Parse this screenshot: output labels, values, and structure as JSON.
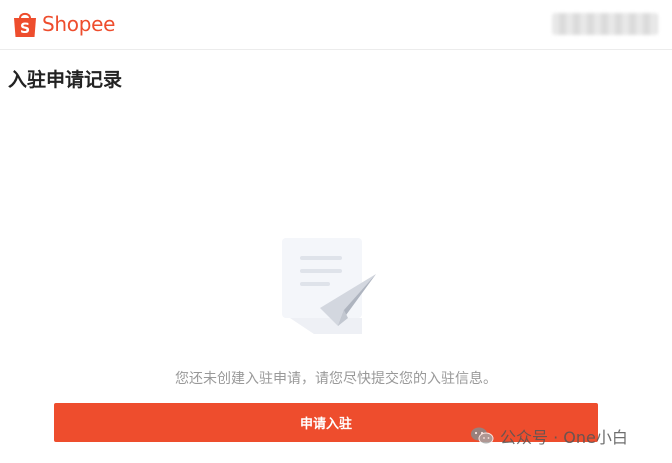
{
  "header": {
    "logo_text": "Shopee",
    "logo_bag_letter": "S"
  },
  "page": {
    "title": "入驻申请记录"
  },
  "empty_state": {
    "illustration": "empty-paper-plane-icon",
    "message": "您还未创建入驻申请，请您尽快提交您的入驻信息。"
  },
  "actions": {
    "apply_label": "申请入驻"
  },
  "watermark": {
    "icon": "wechat-icon",
    "text": "公众号 · One小白"
  },
  "colors": {
    "brand": "#ee4d2d",
    "muted_text": "#999999"
  }
}
